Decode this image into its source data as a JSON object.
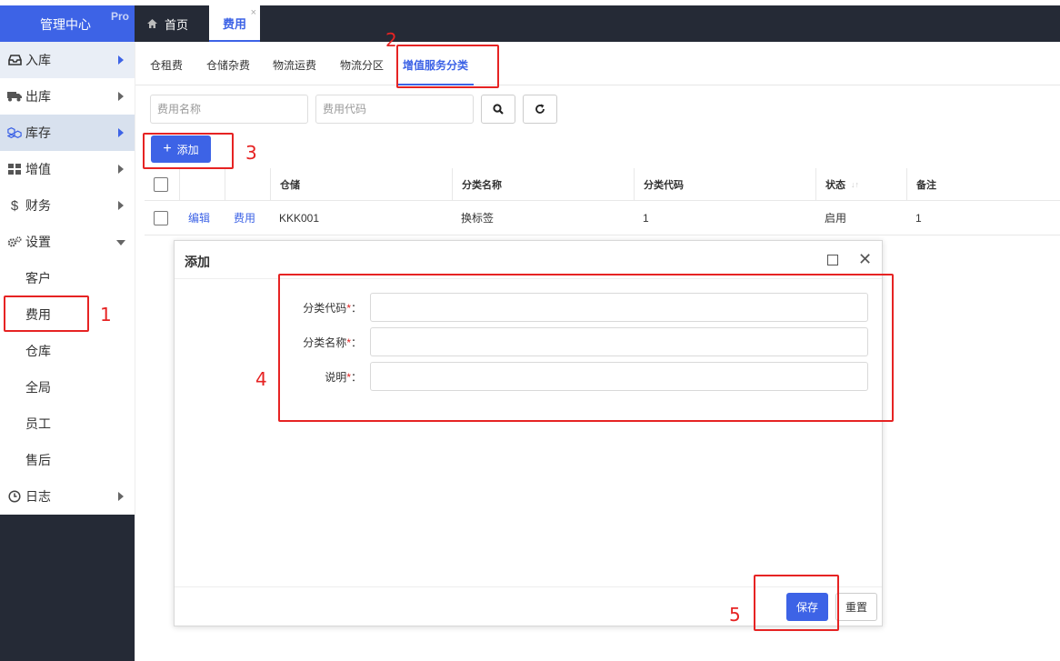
{
  "app": {
    "title": "管理中心",
    "badge": "Pro"
  },
  "header_tabs": [
    {
      "label": "首页",
      "icon": "home-icon"
    },
    {
      "label": "费用",
      "active": true,
      "close": "×"
    }
  ],
  "sidebar": {
    "items": [
      {
        "label": "入库",
        "icon": "inbox-icon"
      },
      {
        "label": "出库",
        "icon": "truck-icon"
      },
      {
        "label": "库存",
        "icon": "cubes-icon"
      },
      {
        "label": "增值",
        "icon": "grid-icon"
      },
      {
        "label": "财务",
        "icon": "dollar-icon"
      },
      {
        "label": "设置",
        "icon": "gears-icon"
      }
    ],
    "settings_sub": [
      "客户",
      "费用",
      "仓库",
      "全局",
      "员工",
      "售后"
    ],
    "log": {
      "label": "日志",
      "icon": "clock-icon"
    }
  },
  "subtabs": [
    "仓租费",
    "仓储杂费",
    "物流运费",
    "物流分区",
    "增值服务分类"
  ],
  "search": {
    "name_placeholder": "费用名称",
    "code_placeholder": "费用代码"
  },
  "toolbar": {
    "add_label": "添加",
    "add_icon": "+"
  },
  "table": {
    "headers": [
      "仓储",
      "分类名称",
      "分类代码",
      "状态",
      "备注"
    ],
    "sort_icon": "↓↑",
    "rows": [
      {
        "edit": "编辑",
        "fee": "费用",
        "warehouse": "KKK001",
        "name": "换标签",
        "code": "1",
        "status": "启用",
        "remark": "1"
      }
    ]
  },
  "modal": {
    "title": "添加",
    "fields": [
      {
        "label": "分类代码",
        "required": "*",
        "colon": "："
      },
      {
        "label": "分类名称",
        "required": "*",
        "colon": "："
      },
      {
        "label": "说明",
        "required": "*",
        "colon": "："
      }
    ],
    "save_label": "保存",
    "reset_label": "重置"
  },
  "annotations": [
    "1",
    "2",
    "3",
    "4",
    "5"
  ],
  "colors": {
    "primary": "#3d63e6",
    "sidebar_dark": "#252a36",
    "annotation": "#e62323"
  }
}
